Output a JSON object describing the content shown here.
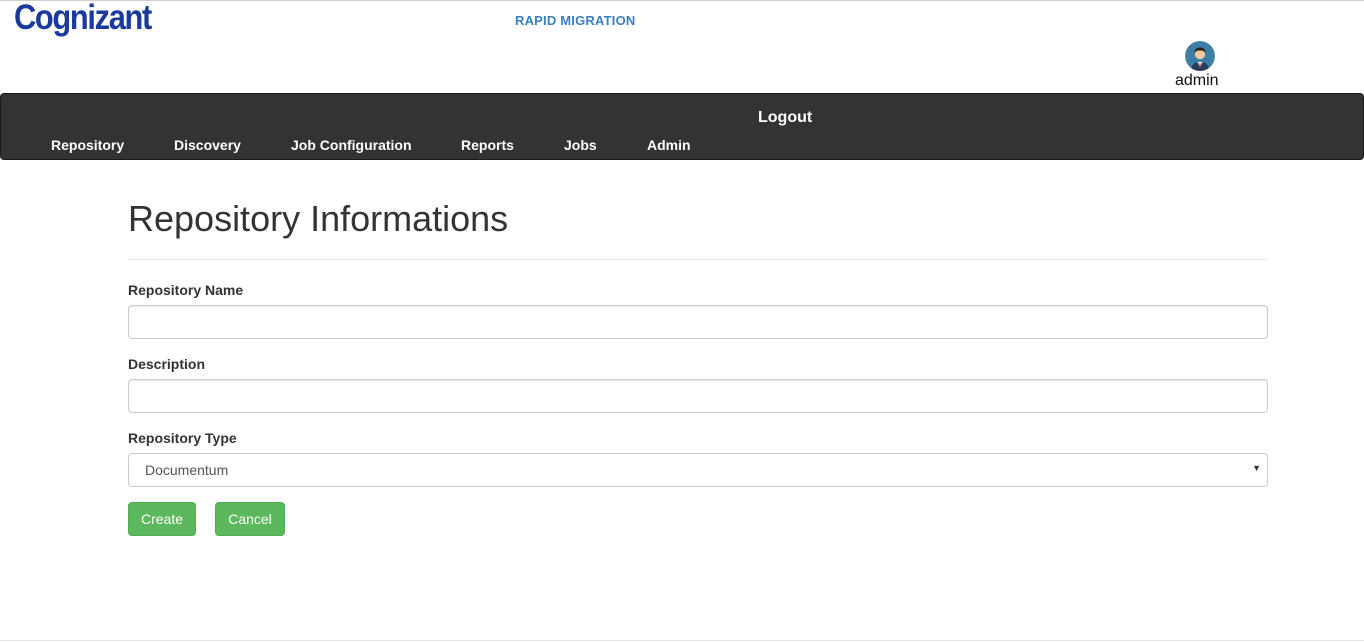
{
  "brand": {
    "logo_text": "Cognizant",
    "app_title": "RAPID MIGRATION"
  },
  "user": {
    "name": "admin",
    "avatar_icon": "user-avatar-icon"
  },
  "navbar": {
    "logout_label": "Logout",
    "items": [
      "Repository",
      "Discovery",
      "Job Configuration",
      "Reports",
      "Jobs",
      "Admin"
    ]
  },
  "form": {
    "title": "Repository Informations",
    "repo_name": {
      "label": "Repository Name",
      "value": ""
    },
    "description": {
      "label": "Description",
      "value": ""
    },
    "repo_type": {
      "label": "Repository Type",
      "selected": "Documentum"
    },
    "create_label": "Create",
    "cancel_label": "Cancel"
  },
  "colors": {
    "navbar_bg": "#333333",
    "brand_blue": "#1a3b9c",
    "app_title_blue": "#3a7fc1",
    "button_green": "#5cb85c"
  }
}
